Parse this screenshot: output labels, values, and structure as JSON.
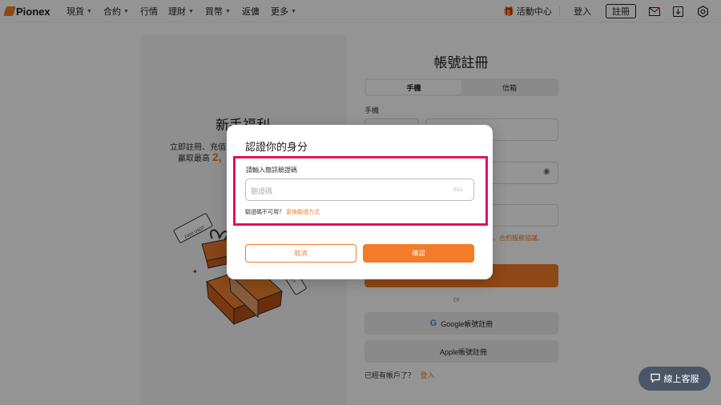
{
  "nav": {
    "logo": "Pionex",
    "items": [
      {
        "label": "現貨",
        "caret": true
      },
      {
        "label": "合約",
        "caret": true
      },
      {
        "label": "行情",
        "caret": false
      },
      {
        "label": "理財",
        "caret": true
      },
      {
        "label": "買幣",
        "caret": true
      },
      {
        "label": "返傭",
        "caret": false
      },
      {
        "label": "更多",
        "caret": true
      }
    ],
    "activity": "活動中心",
    "login": "登入",
    "register": "註冊"
  },
  "promo": {
    "title": "新手福利",
    "line1": "立即註冊、充值",
    "line2_prefix": "贏取最高",
    "amount": "2,",
    "coupon1": "2000 USDT",
    "coupon2": "USDT"
  },
  "form": {
    "title": "帳號註冊",
    "tab_phone": "手機",
    "tab_email": "信箱",
    "phone_label": "手機",
    "terms_text": "、合約服務協議、",
    "or": "or",
    "google_btn": "Google帳號註冊",
    "apple_btn": "Apple帳號註冊",
    "have_account": "已經有帳戶了？",
    "login_link": "登入"
  },
  "modal": {
    "title": "認證你的身分",
    "input_label": "請輸入簡訊驗證碼",
    "placeholder": "驗證碼",
    "countdown": "51s",
    "hint": "驗證碼不可用？",
    "hint_link": "更換驗證方式",
    "cancel": "取消",
    "confirm": "確認"
  },
  "chat": {
    "label": "線上客服"
  },
  "colors": {
    "accent": "#f47b28",
    "highlight": "#e0115f"
  }
}
